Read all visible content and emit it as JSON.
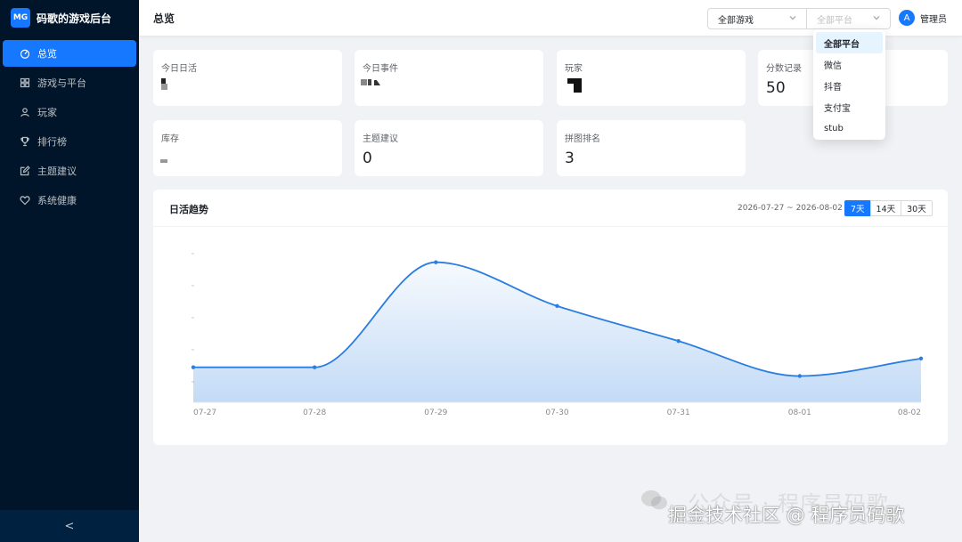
{
  "brand": {
    "logo_text": "MG",
    "title": "码歌的游戏后台",
    "accent": "#1677ff"
  },
  "sidebar": {
    "items": [
      {
        "label": "总览",
        "icon": "dashboard-icon",
        "active": true
      },
      {
        "label": "游戏与平台",
        "icon": "grid-icon",
        "active": false
      },
      {
        "label": "玩家",
        "icon": "user-icon",
        "active": false
      },
      {
        "label": "排行榜",
        "icon": "trophy-icon",
        "active": false
      },
      {
        "label": "主题建议",
        "icon": "edit-icon",
        "active": false
      },
      {
        "label": "系统健康",
        "icon": "heart-icon",
        "active": false
      }
    ],
    "collapse_label": "<"
  },
  "header": {
    "title": "总览",
    "game_select": {
      "value": "全部游戏"
    },
    "platform_select": {
      "placeholder": "全部平台"
    },
    "user": {
      "avatar_letter": "A",
      "name": "管理员"
    }
  },
  "stats": [
    {
      "label": "今日日活",
      "value": ""
    },
    {
      "label": "今日事件",
      "value": ""
    },
    {
      "label": "玩家",
      "value": ""
    },
    {
      "label": "分数记录",
      "value": "50"
    },
    {
      "label": "库存",
      "value": ""
    },
    {
      "label": "主题建议",
      "value": "0"
    },
    {
      "label": "拼图排名",
      "value": "3"
    }
  ],
  "chart": {
    "title": "日活趋势",
    "date_range": "2026-07-27 ~ 2026-08-02",
    "range_buttons": [
      {
        "label": "7天",
        "active": true
      },
      {
        "label": "14天",
        "active": false
      },
      {
        "label": "30天",
        "active": false
      }
    ]
  },
  "chart_data": {
    "type": "area",
    "categories": [
      "07-27",
      "07-28",
      "07-29",
      "07-30",
      "07-31",
      "08-01",
      "08-02"
    ],
    "series": [
      {
        "values": [
          1,
          1,
          7,
          4.5,
          2.5,
          0.5,
          1.5
        ]
      }
    ],
    "ylim": [
      -1,
      8
    ],
    "grid": false,
    "color": "#2a7de1"
  },
  "platform_dropdown": {
    "options": [
      {
        "label": "全部平台",
        "active": true
      },
      {
        "label": "微信",
        "active": false
      },
      {
        "label": "抖音",
        "active": false
      },
      {
        "label": "支付宝",
        "active": false
      },
      {
        "label": "stub",
        "active": false
      }
    ]
  },
  "watermark": {
    "line1": "公众号 · 程序员码歌",
    "line2": "掘金技术社区 @ 程序员码歌"
  }
}
